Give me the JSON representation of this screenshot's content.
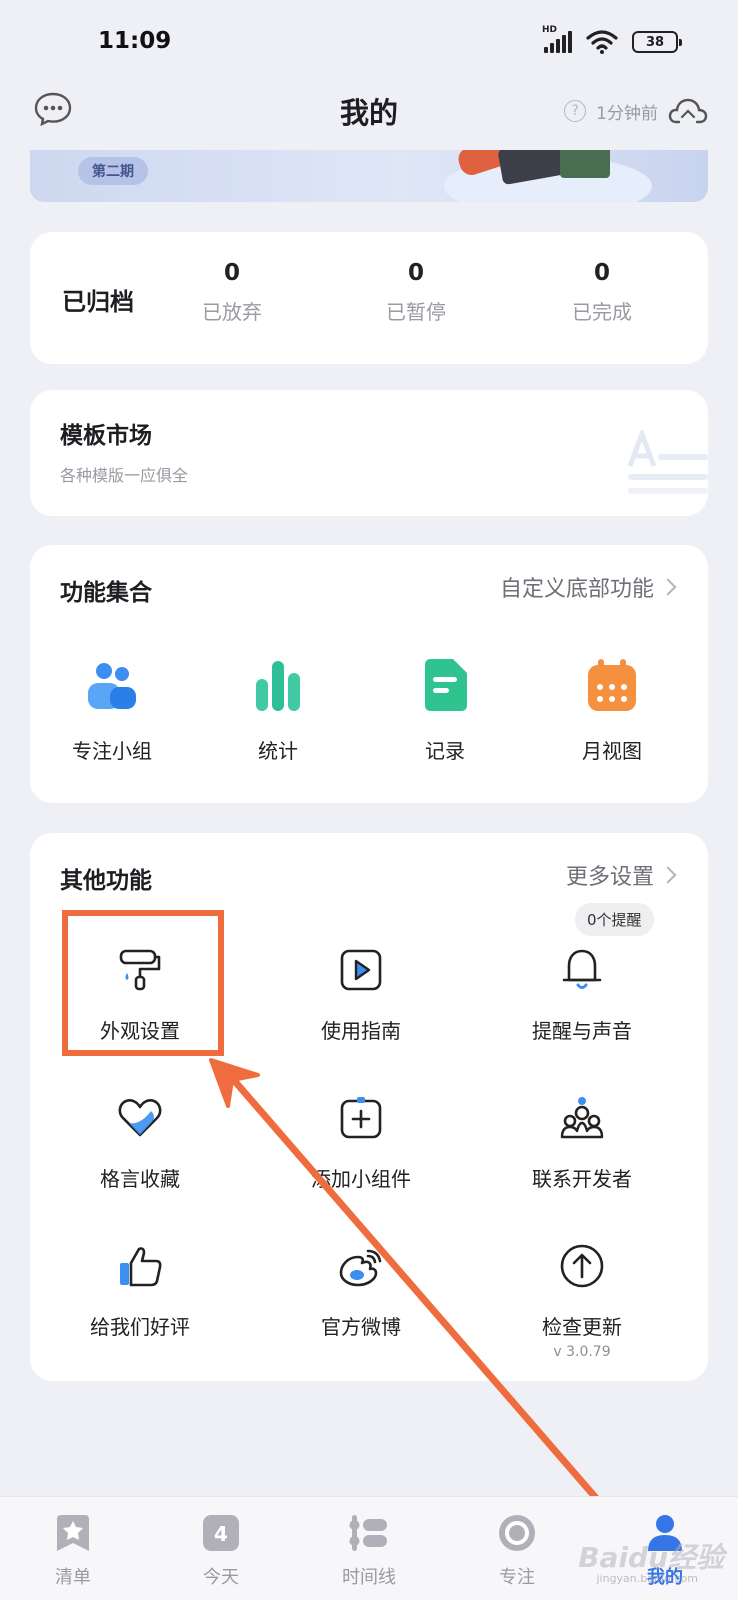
{
  "status_bar": {
    "time": "11:09",
    "network": "HD",
    "battery": "38"
  },
  "header": {
    "title": "我的",
    "sync_time": "1分钟前",
    "help_icon": "?"
  },
  "banner": {
    "tag": "第二期"
  },
  "archive": {
    "title": "已归档",
    "stats": [
      {
        "value": "0",
        "label": "已放弃"
      },
      {
        "value": "0",
        "label": "已暂停"
      },
      {
        "value": "0",
        "label": "已完成"
      }
    ]
  },
  "template_market": {
    "title": "模板市场",
    "subtitle": "各种模版一应俱全"
  },
  "features": {
    "title": "功能集合",
    "link": "自定义底部功能",
    "items": [
      {
        "label": "专注小组",
        "icon": "group-icon"
      },
      {
        "label": "统计",
        "icon": "bar-chart-icon"
      },
      {
        "label": "记录",
        "icon": "record-icon"
      },
      {
        "label": "月视图",
        "icon": "calendar-icon"
      }
    ]
  },
  "other": {
    "title": "其他功能",
    "link": "更多设置",
    "reminder_badge": "0个提醒",
    "items": [
      {
        "label": "外观设置",
        "icon": "paint-roller-icon"
      },
      {
        "label": "使用指南",
        "icon": "play-guide-icon"
      },
      {
        "label": "提醒与声音",
        "icon": "bell-icon"
      },
      {
        "label": "格言收藏",
        "icon": "heart-icon"
      },
      {
        "label": "添加小组件",
        "icon": "add-widget-icon"
      },
      {
        "label": "联系开发者",
        "icon": "contact-developer-icon"
      },
      {
        "label": "给我们好评",
        "icon": "thumbs-up-icon"
      },
      {
        "label": "官方微博",
        "icon": "weibo-icon"
      },
      {
        "label": "检查更新",
        "icon": "upload-arrow-icon"
      }
    ],
    "version": "v 3.0.79"
  },
  "tabbar": {
    "items": [
      {
        "label": "清单",
        "icon": "star-list-icon"
      },
      {
        "label": "今天",
        "icon": "today-icon",
        "badge": "4"
      },
      {
        "label": "时间线",
        "icon": "timeline-icon"
      },
      {
        "label": "专注",
        "icon": "focus-icon"
      },
      {
        "label": "我的",
        "icon": "profile-icon"
      }
    ]
  },
  "watermark": {
    "text": "Baidu经验",
    "sub": "jingyan.baidu.com"
  },
  "colors": {
    "accent": "#3575e8",
    "highlight": "#ef6c3e",
    "background": "#eff0f5"
  }
}
